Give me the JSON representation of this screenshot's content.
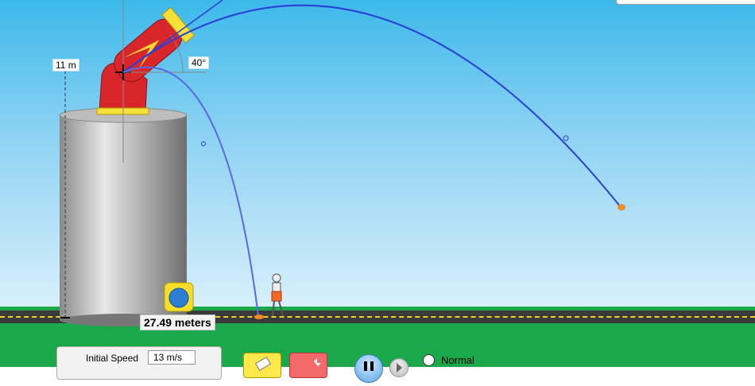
{
  "scene": {
    "height_label": "11 m",
    "angle_label": "40°",
    "distance_label": "27.49 meters"
  },
  "controls": {
    "initial_speed_label": "Initial Speed",
    "initial_speed_value": "13 m/s",
    "speed_option_label": "Normal"
  },
  "colors": {
    "sky": "#3cb9ea",
    "ground": "#1ba84a",
    "trajectory": "#2a3fd6",
    "cannon": "#d8262b",
    "road_line": "#f2d21b"
  },
  "icons": [
    "eraser-icon",
    "fire-cannon-icon",
    "pause-icon",
    "step-icon",
    "tape-measure-icon",
    "crosshair-icon"
  ]
}
